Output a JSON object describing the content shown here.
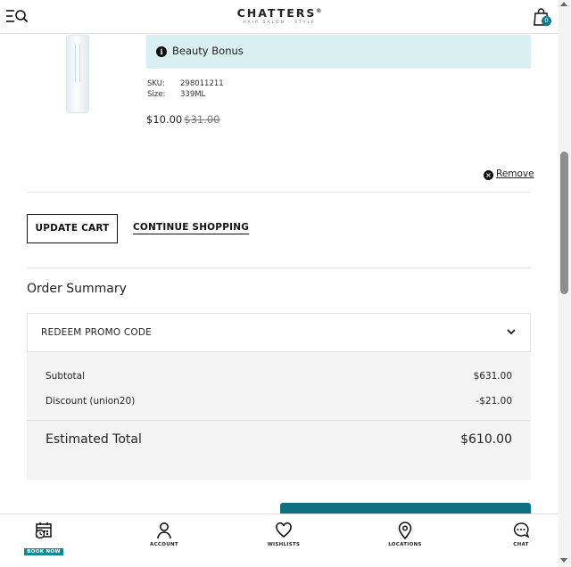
{
  "header": {
    "brand": "CHATTERS",
    "brand_mark": "®",
    "brand_sub": "HAIR SALON · STYLE",
    "cart_count": "0"
  },
  "product": {
    "bonus_text": "Beauty Bonus",
    "sku_label": "SKU:",
    "sku_value": "298011211",
    "size_label": "Size:",
    "size_value": "339ML",
    "price": "$10.00",
    "original_price": "$31.00",
    "remove_label": "Remove"
  },
  "cart_actions": {
    "update_label": "UPDATE CART",
    "continue_label": "CONTINUE SHOPPING"
  },
  "summary": {
    "title": "Order Summary",
    "promo_label": "REDEEM PROMO CODE",
    "subtotal_label": "Subtotal",
    "subtotal_value": "$631.00",
    "discount_label": "Discount (union20)",
    "discount_value": "-$21.00",
    "total_label": "Estimated Total",
    "total_value": "$610.00"
  },
  "bottom_nav": {
    "items": [
      {
        "label": "BOOK NOW",
        "icon": "calendar-clock-icon"
      },
      {
        "label": "ACCOUNT",
        "icon": "user-icon"
      },
      {
        "label": "WISHLISTS",
        "icon": "heart-icon"
      },
      {
        "label": "LOCATIONS",
        "icon": "map-pin-icon"
      },
      {
        "label": "CHAT",
        "icon": "chat-icon"
      }
    ]
  },
  "colors": {
    "accent": "#0f7c8a",
    "bonus_bg": "#d9eff2",
    "totals_bg": "#f4f4f4"
  }
}
